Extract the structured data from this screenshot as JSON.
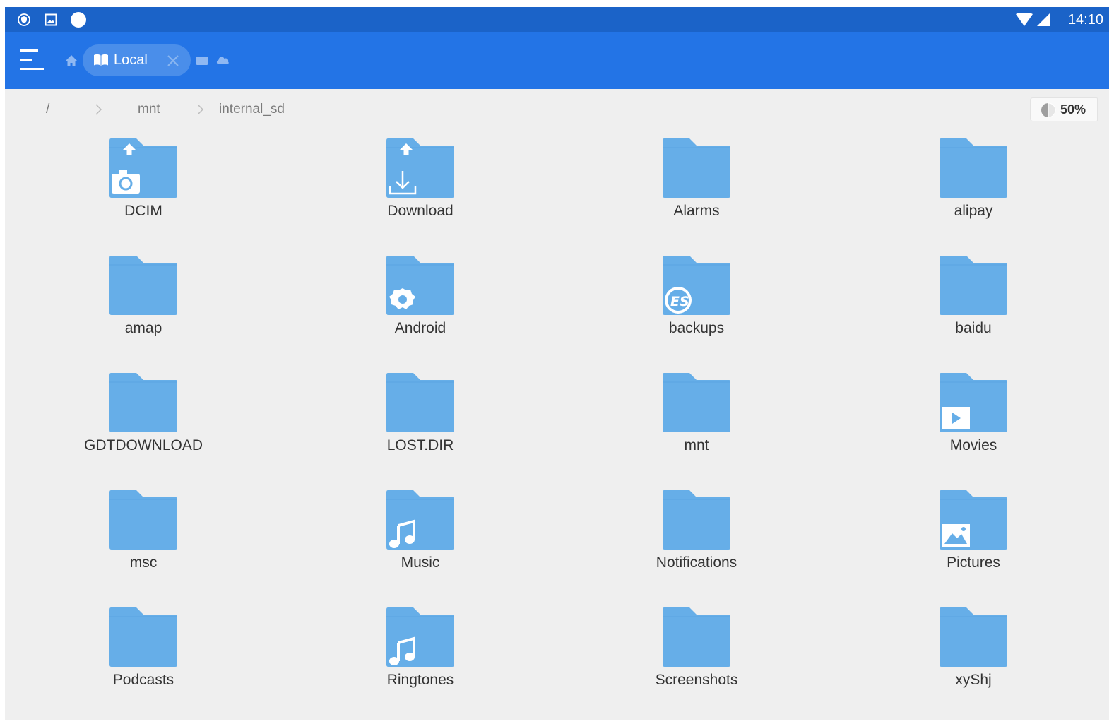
{
  "status_bar": {
    "time": "14:10",
    "icons": [
      "shield-icon",
      "image-notification-icon",
      "circle-notification-icon",
      "wifi-icon",
      "cell-signal-icon"
    ]
  },
  "toolbar": {
    "menu_icon": "hamburger-menu-icon",
    "home_icon": "home-icon",
    "tab_label": "Local",
    "tab_icon": "book-icon",
    "extra_icons": [
      "window-icon",
      "cloud-icon"
    ]
  },
  "breadcrumb": {
    "items": [
      "/",
      "mnt",
      "internal_sd"
    ],
    "storage_percent": "50%",
    "storage_fraction": 0.5
  },
  "colors": {
    "status_bar": "#1b63c8",
    "toolbar": "#2374e6",
    "tab_pill": "#4a8eea",
    "folder": "#66aee8",
    "folder_tab": "#5aa3e2",
    "background": "#efefef"
  },
  "folders": [
    {
      "name": "DCIM",
      "badge": "camera-icon",
      "upload": true
    },
    {
      "name": "Download",
      "badge": "download-icon",
      "upload": true
    },
    {
      "name": "Alarms",
      "badge": "",
      "upload": false
    },
    {
      "name": "alipay",
      "badge": "",
      "upload": false
    },
    {
      "name": "amap",
      "badge": "",
      "upload": false
    },
    {
      "name": "Android",
      "badge": "android-gear-icon",
      "upload": false
    },
    {
      "name": "backups",
      "badge": "es-logo-icon",
      "upload": false
    },
    {
      "name": "baidu",
      "badge": "",
      "upload": false
    },
    {
      "name": "GDTDOWNLOAD",
      "badge": "",
      "upload": false
    },
    {
      "name": "LOST.DIR",
      "badge": "",
      "upload": false
    },
    {
      "name": "mnt",
      "badge": "",
      "upload": false
    },
    {
      "name": "Movies",
      "badge": "play-icon",
      "upload": false
    },
    {
      "name": "msc",
      "badge": "",
      "upload": false
    },
    {
      "name": "Music",
      "badge": "music-note-icon",
      "upload": false
    },
    {
      "name": "Notifications",
      "badge": "",
      "upload": false
    },
    {
      "name": "Pictures",
      "badge": "picture-icon",
      "upload": false
    },
    {
      "name": "Podcasts",
      "badge": "",
      "upload": false
    },
    {
      "name": "Ringtones",
      "badge": "music-note-icon",
      "upload": false
    },
    {
      "name": "Screenshots",
      "badge": "",
      "upload": false
    },
    {
      "name": "xyShj",
      "badge": "",
      "upload": false
    }
  ]
}
